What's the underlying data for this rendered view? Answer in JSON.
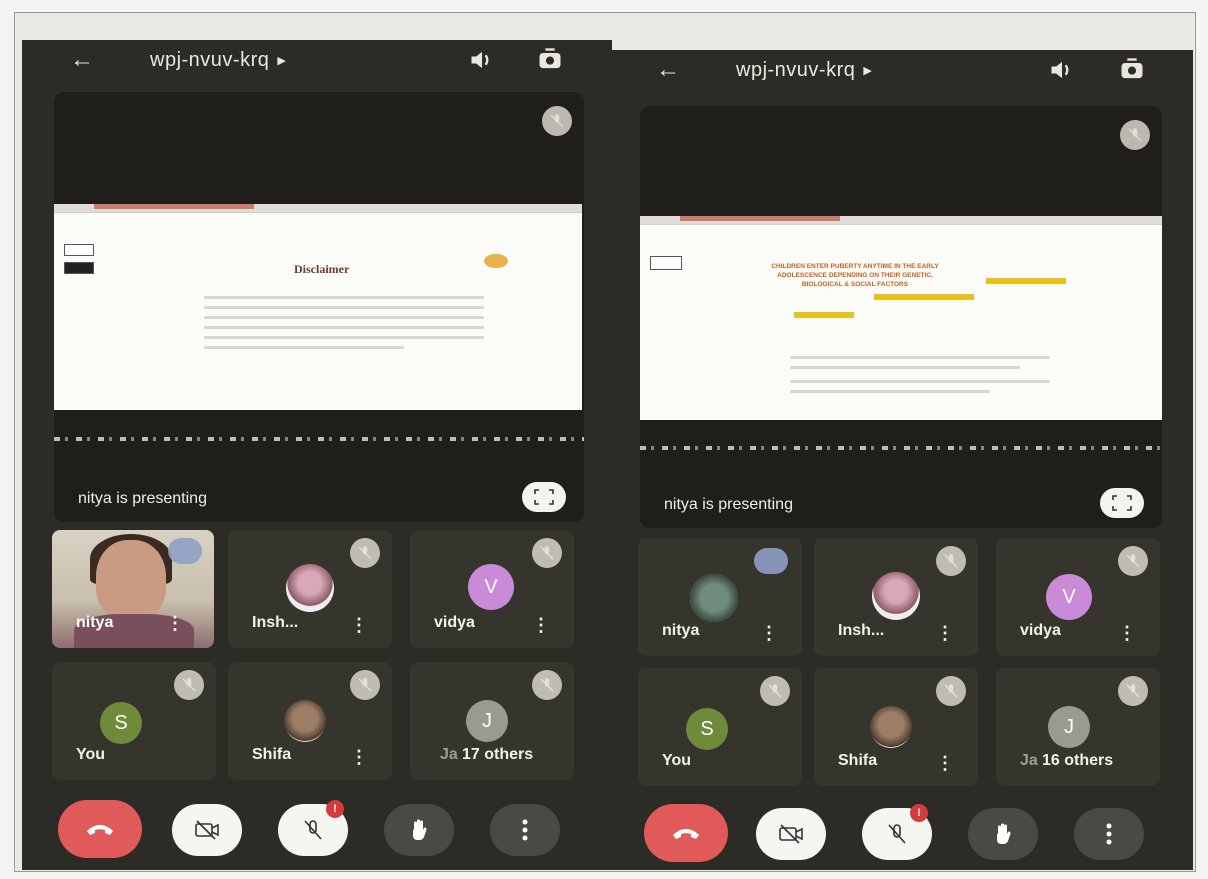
{
  "screens": [
    {
      "meeting_code": "wpj-nvuv-krq",
      "presenting_label": "nitya is presenting",
      "slide_title": "Disclaimer",
      "participants": [
        {
          "name": "nitya"
        },
        {
          "name": "Insh..."
        },
        {
          "name": "vidya",
          "initial": "V"
        },
        {
          "name": "You",
          "initial": "S"
        },
        {
          "name": "Shifa"
        },
        {
          "name": "Ja",
          "initial": "J"
        }
      ],
      "others_label": "17 others",
      "mic_notification": "!"
    },
    {
      "meeting_code": "wpj-nvuv-krq",
      "presenting_label": "nitya is presenting",
      "slide_heading": "CHILDREN ENTER PUBERTY ANYTIME IN THE EARLY ADOLESCENCE DEPENDING ON THEIR GENETIC, BIOLOGICAL & SOCIAL FACTORS",
      "participants": [
        {
          "name": "nitya"
        },
        {
          "name": "Insh..."
        },
        {
          "name": "vidya",
          "initial": "V"
        },
        {
          "name": "You",
          "initial": "S"
        },
        {
          "name": "Shifa"
        },
        {
          "name": "Ja",
          "initial": "J"
        }
      ],
      "others_label": "16 others",
      "mic_notification": "!"
    }
  ],
  "colors": {
    "call_bg": "#2c2b25",
    "end_call": "#e05a5a",
    "avatar_s": "#6f8a3a",
    "avatar_v": "#c98ad8",
    "avatar_j": "#9a9a92"
  },
  "icons": [
    "back-arrow-icon",
    "caret-right-icon",
    "speaker-icon",
    "switch-camera-icon",
    "mic-off-icon",
    "fullscreen-icon",
    "end-call-icon",
    "camera-off-icon",
    "raise-hand-icon",
    "more-vert-icon"
  ]
}
